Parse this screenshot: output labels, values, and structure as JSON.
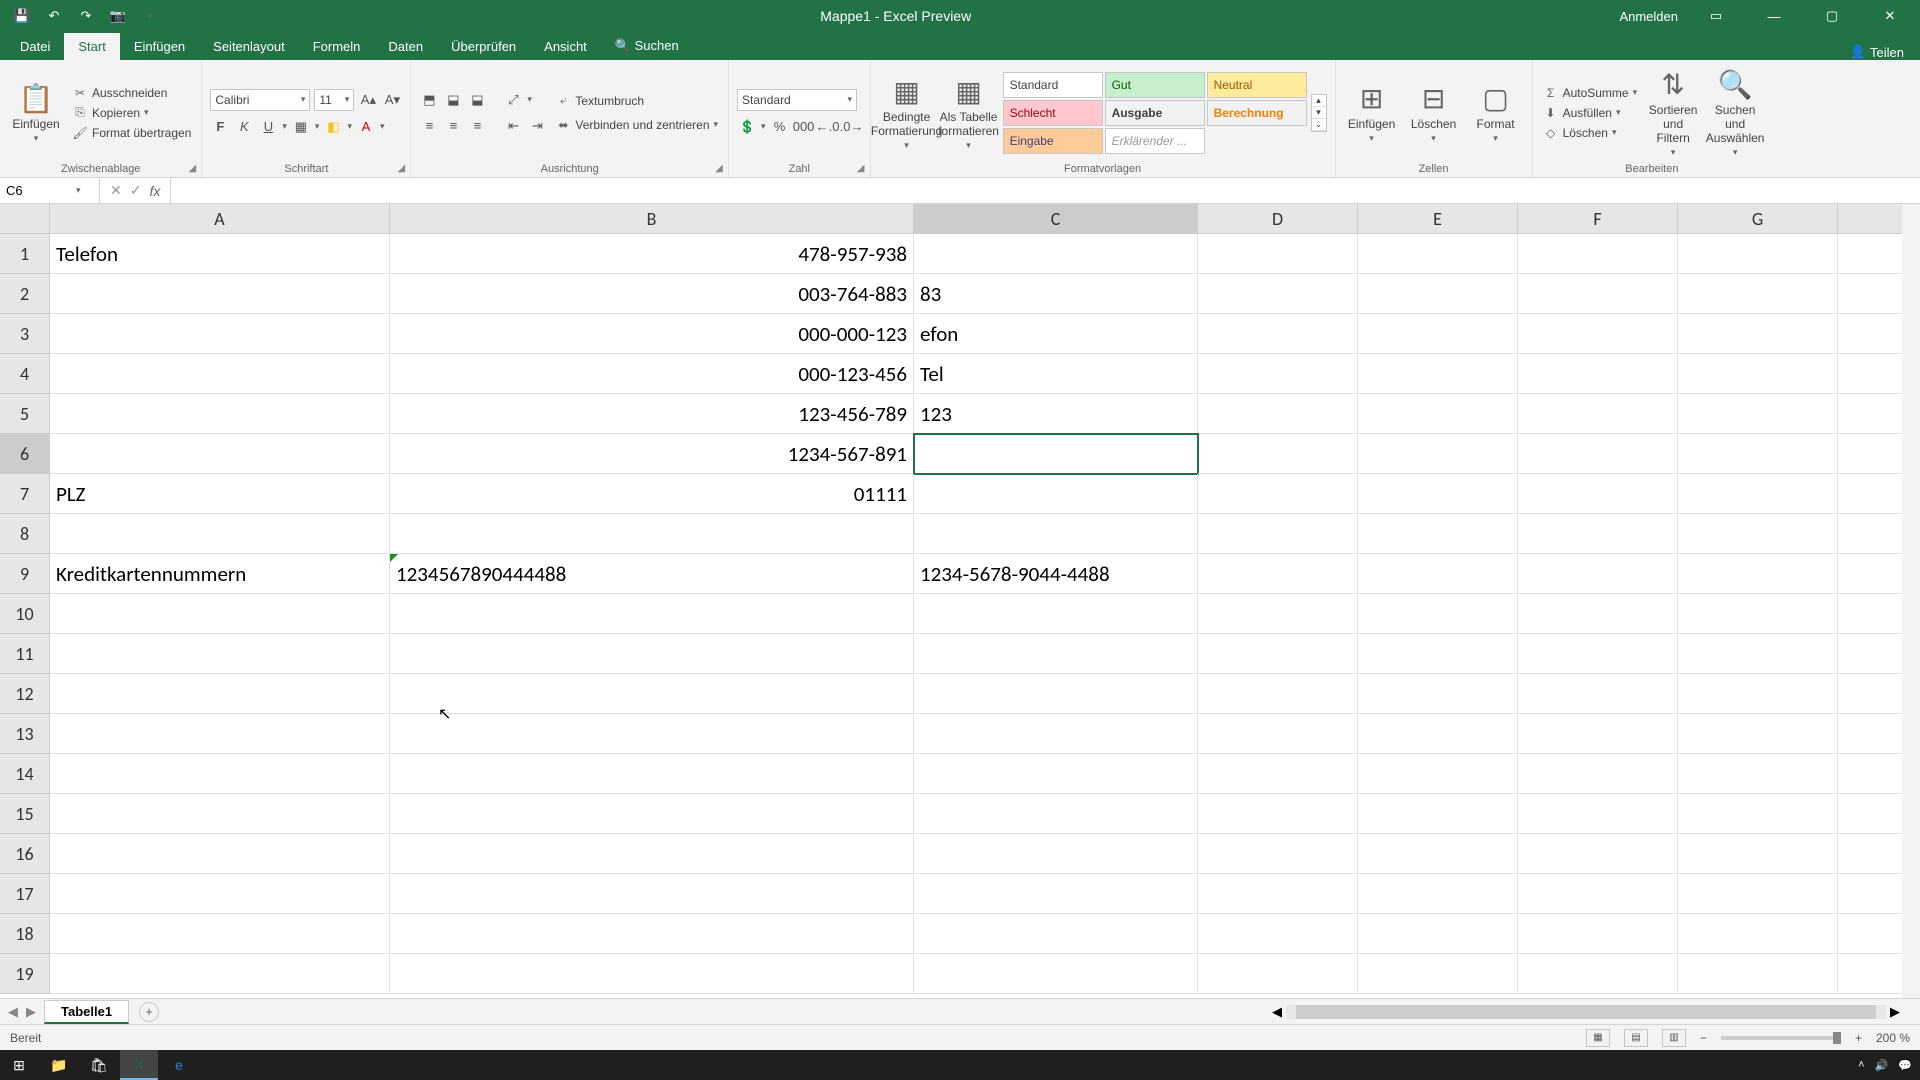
{
  "titlebar": {
    "title": "Mappe1 - Excel Preview",
    "signin": "Anmelden"
  },
  "tabs": {
    "file": "Datei",
    "home": "Start",
    "insert": "Einfügen",
    "layout": "Seitenlayout",
    "formulas": "Formeln",
    "data": "Daten",
    "review": "Überprüfen",
    "view": "Ansicht",
    "search": "Suchen",
    "share": "Teilen"
  },
  "ribbon": {
    "clipboard": {
      "label": "Zwischenablage",
      "paste": "Einfügen",
      "cut": "Ausschneiden",
      "copy": "Kopieren",
      "format_painter": "Format übertragen"
    },
    "font": {
      "label": "Schriftart",
      "name": "Calibri",
      "size": "11"
    },
    "align": {
      "label": "Ausrichtung",
      "wrap": "Textumbruch",
      "merge": "Verbinden und zentrieren"
    },
    "number": {
      "label": "Zahl",
      "format": "Standard"
    },
    "styles": {
      "label": "Formatvorlagen",
      "cond": "Bedingte\nFormatierung",
      "table": "Als Tabelle\nformatieren",
      "standard": "Standard",
      "gut": "Gut",
      "neutral": "Neutral",
      "schlecht": "Schlecht",
      "ausgabe": "Ausgabe",
      "berechnung": "Berechnung",
      "eingabe": "Eingabe",
      "erkl": "Erklärender ..."
    },
    "cells": {
      "label": "Zellen",
      "insert": "Einfügen",
      "delete": "Löschen",
      "format": "Format"
    },
    "editing": {
      "label": "Bearbeiten",
      "sum": "AutoSumme",
      "fill": "Ausfüllen",
      "clear": "Löschen",
      "sort": "Sortieren und\nFiltern",
      "find": "Suchen und\nAuswählen"
    }
  },
  "formula": {
    "namebox": "C6",
    "value": ""
  },
  "columns": [
    "A",
    "B",
    "C",
    "D",
    "E",
    "F",
    "G"
  ],
  "rows": [
    1,
    2,
    3,
    4,
    5,
    6,
    7,
    8,
    9,
    10,
    11,
    12,
    13,
    14,
    15,
    16,
    17,
    18,
    19
  ],
  "selected": {
    "col": "C",
    "row": 6
  },
  "cells": {
    "A1": "Telefon",
    "B1": "478-957-938",
    "B2": "003-764-883",
    "C2": "83",
    "B3": "000-000-123",
    "C3": "efon",
    "B4": "000-123-456",
    "C4": "Tel",
    "B5": "123-456-789",
    "C5": "123",
    "B6": "1234-567-891",
    "A7": "PLZ",
    "B7": "01111",
    "A9": "Kreditkartennummern",
    "B9": "1234567890444488",
    "C9": "1234-5678-9044-4488"
  },
  "sheet": {
    "tab": "Tabelle1"
  },
  "status": {
    "ready": "Bereit",
    "zoom": "200 %"
  }
}
